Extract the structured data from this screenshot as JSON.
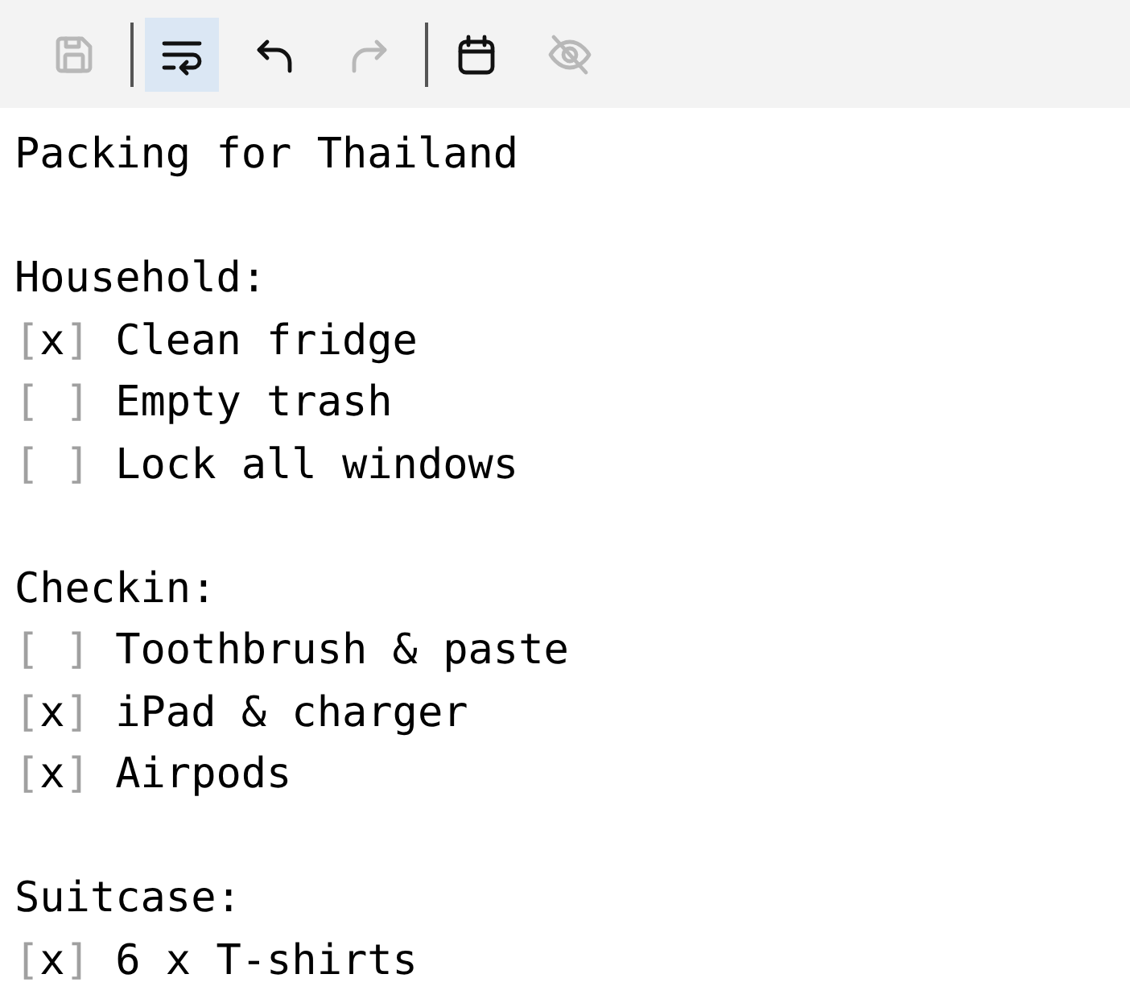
{
  "toolbar": [
    {
      "kind": "save",
      "disabled": true,
      "selected": false,
      "separator_after": true
    },
    {
      "kind": "wrap",
      "disabled": false,
      "selected": true,
      "separator_after": false
    },
    {
      "kind": "undo",
      "disabled": false,
      "selected": false,
      "separator_after": false
    },
    {
      "kind": "redo",
      "disabled": true,
      "selected": false,
      "separator_after": true
    },
    {
      "kind": "calendar",
      "disabled": false,
      "selected": false,
      "separator_after": false
    },
    {
      "kind": "hide",
      "disabled": true,
      "selected": false,
      "separator_after": false
    }
  ],
  "title": "Packing for Thailand",
  "sections": [
    {
      "heading": "Household:",
      "items": [
        {
          "checkbox": "[x]",
          "text": "Clean fridge"
        },
        {
          "checkbox": "[ ]",
          "text": "Empty trash"
        },
        {
          "checkbox": "[ ]",
          "text": "Lock all windows"
        }
      ]
    },
    {
      "heading": "Checkin:",
      "items": [
        {
          "checkbox": "[ ]",
          "text": "Toothbrush & paste"
        },
        {
          "checkbox": "[x]",
          "text": "iPad & charger"
        },
        {
          "checkbox": "[x]",
          "text": "Airpods"
        }
      ]
    },
    {
      "heading": "Suitcase:",
      "items": [
        {
          "checkbox": "[x]",
          "text": "6 x T-shirts"
        }
      ]
    }
  ]
}
